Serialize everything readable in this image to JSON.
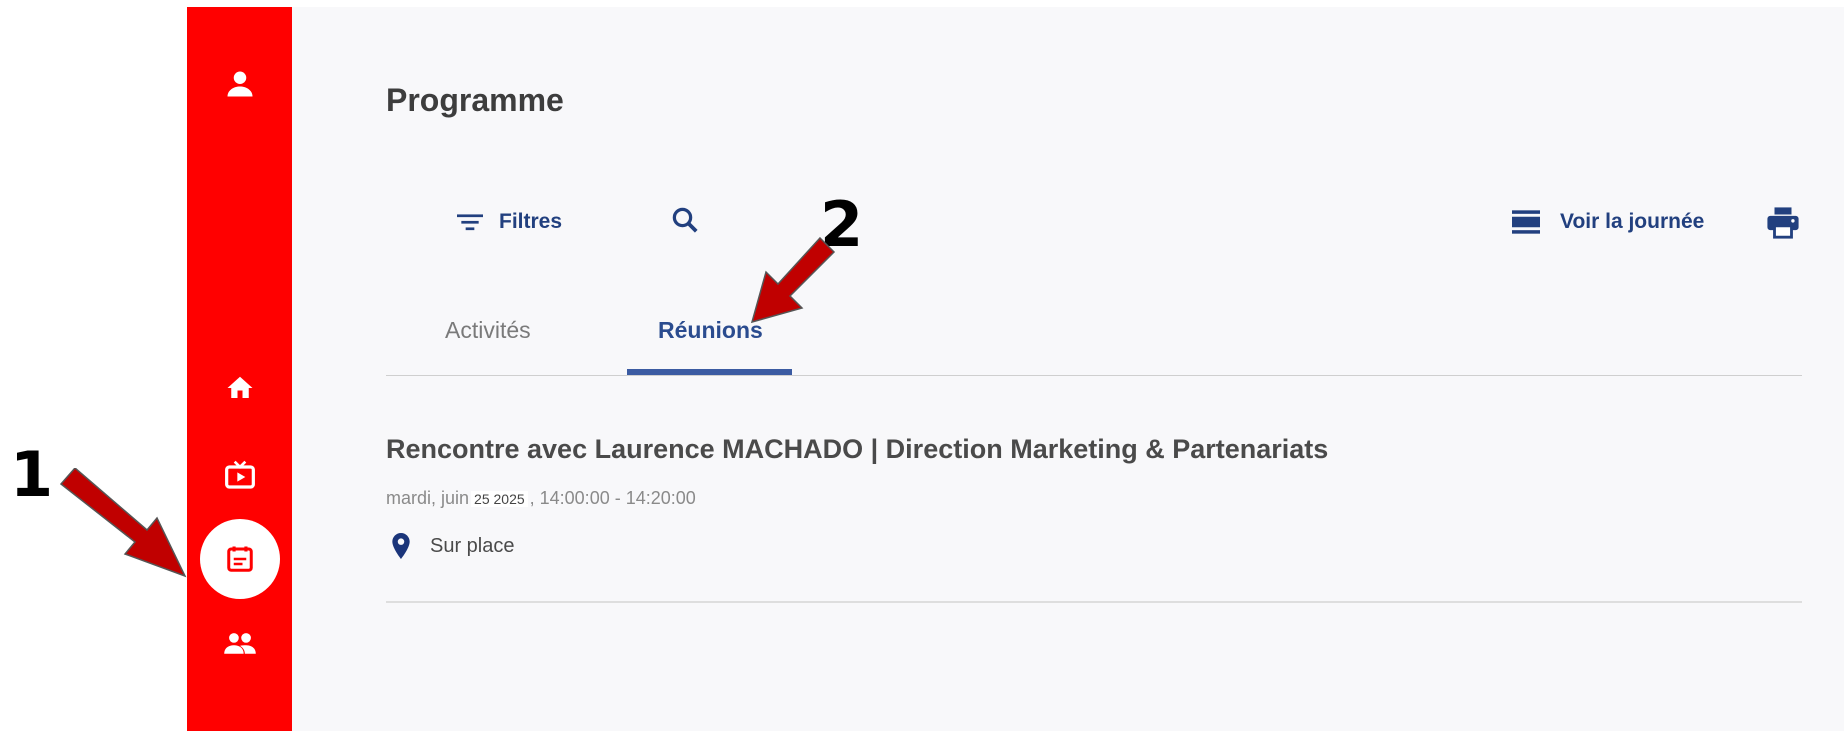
{
  "sidebar": {
    "items": [
      {
        "icon": "user-icon"
      },
      {
        "icon": "home-icon"
      },
      {
        "icon": "tv-icon"
      },
      {
        "icon": "calendar-icon",
        "active": true
      },
      {
        "icon": "people-icon"
      }
    ],
    "color": "#ff0000"
  },
  "main": {
    "title": "Programme",
    "toolbar": {
      "filters_label": "Filtres",
      "view_day_label": "Voir la journée"
    },
    "tabs": [
      {
        "label": "Activités",
        "active": false
      },
      {
        "label": "Réunions",
        "active": true
      }
    ],
    "meeting": {
      "title": "Rencontre avec Laurence MACHADO | Direction Marketing & Partenariats",
      "date_prefix": "mardi, juin",
      "date_box": "25 2025",
      "time": ", 14:00:00 - 14:20:00",
      "location": "Sur place"
    }
  },
  "annotations": {
    "step1": "1",
    "step2": "2",
    "arrow_color": "#c00000"
  }
}
